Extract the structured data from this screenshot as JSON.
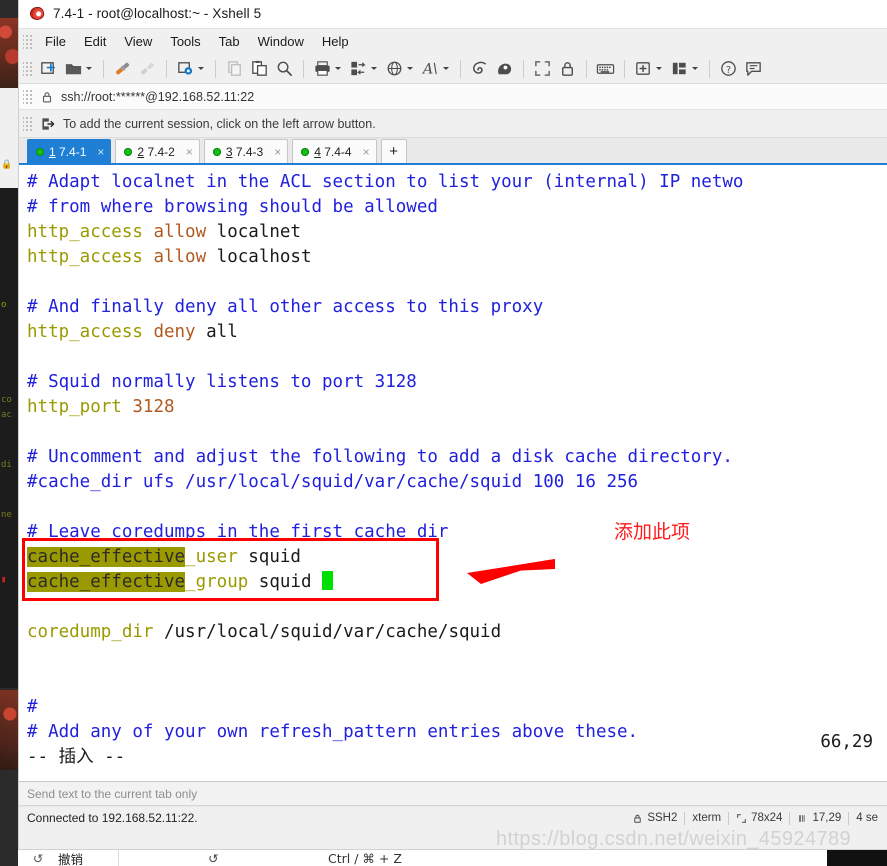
{
  "window": {
    "title": "7.4-1 - root@localhost:~ - Xshell 5",
    "app_icon": "xshell-icon"
  },
  "menu": {
    "items": [
      "File",
      "Edit",
      "View",
      "Tools",
      "Tab",
      "Window",
      "Help"
    ]
  },
  "toolbar": {
    "buttons": [
      {
        "name": "new-session-icon",
        "caret": false
      },
      {
        "name": "open-session-icon",
        "caret": true
      },
      {
        "name": "connect-icon",
        "caret": false
      },
      {
        "name": "disconnect-icon",
        "caret": false
      },
      {
        "name": "session-properties-icon",
        "caret": true
      },
      {
        "name": "copy-icon",
        "caret": false
      },
      {
        "name": "paste-icon",
        "caret": false
      },
      {
        "name": "find-icon",
        "caret": false
      },
      {
        "name": "print-icon",
        "caret": true
      },
      {
        "name": "file-transfer-icon",
        "caret": true
      },
      {
        "name": "web-browser-icon",
        "caret": true
      },
      {
        "name": "font-icon",
        "caret": true
      },
      {
        "name": "xshell-icon",
        "caret": false
      },
      {
        "name": "xftp-icon",
        "caret": false
      },
      {
        "name": "fullscreen-icon",
        "caret": false
      },
      {
        "name": "lock-icon",
        "caret": false
      },
      {
        "name": "keyboard-icon",
        "caret": false
      },
      {
        "name": "new-pane-icon",
        "caret": true
      },
      {
        "name": "arrange-layout-icon",
        "caret": true
      },
      {
        "name": "help-icon",
        "caret": false
      },
      {
        "name": "feedback-icon",
        "caret": false
      }
    ]
  },
  "urlbar": {
    "icon": "lock-icon",
    "value": "ssh://root:******@192.168.52.11:22"
  },
  "hintbar": {
    "icon": "add-session-arrow-icon",
    "text": "To add the current session, click on the left arrow button."
  },
  "tabs": {
    "items": [
      {
        "index": "1",
        "label": "7.4-1",
        "active": true
      },
      {
        "index": "2",
        "label": "7.4-2",
        "active": false
      },
      {
        "index": "3",
        "label": "7.4-3",
        "active": false
      },
      {
        "index": "4",
        "label": "7.4-4",
        "active": false
      }
    ],
    "add_label": "+",
    "close_glyph": "×",
    "accent_color": "#1f7fd4",
    "status_dot_color": "#16bd16"
  },
  "terminal": {
    "lines": [
      [
        {
          "t": "# Adapt localnet in the ACL section to list your (internal) IP netwo",
          "c": "comment"
        }
      ],
      [
        {
          "t": "# from where browsing should be allowed",
          "c": "comment"
        }
      ],
      [
        {
          "t": "http_access",
          "c": "key"
        },
        {
          "t": " ",
          "c": "plain"
        },
        {
          "t": "allow",
          "c": "val"
        },
        {
          "t": " localnet",
          "c": "plain"
        }
      ],
      [
        {
          "t": "http_access",
          "c": "key"
        },
        {
          "t": " ",
          "c": "plain"
        },
        {
          "t": "allow",
          "c": "val"
        },
        {
          "t": " localhost",
          "c": "plain"
        }
      ],
      [
        {
          "t": "",
          "c": "plain"
        }
      ],
      [
        {
          "t": "# And finally deny all other access to this proxy",
          "c": "comment"
        }
      ],
      [
        {
          "t": "http_access",
          "c": "key"
        },
        {
          "t": " ",
          "c": "plain"
        },
        {
          "t": "deny",
          "c": "val"
        },
        {
          "t": " all",
          "c": "plain"
        }
      ],
      [
        {
          "t": "",
          "c": "plain"
        }
      ],
      [
        {
          "t": "# Squid normally listens to port 3128",
          "c": "comment"
        }
      ],
      [
        {
          "t": "http_port",
          "c": "key"
        },
        {
          "t": " ",
          "c": "plain"
        },
        {
          "t": "3128",
          "c": "val"
        }
      ],
      [
        {
          "t": "",
          "c": "plain"
        }
      ],
      [
        {
          "t": "# Uncomment and adjust the following to add a disk cache directory.",
          "c": "comment"
        }
      ],
      [
        {
          "t": "#cache_dir ufs /usr/local/squid/var/cache/squid 100 16 256",
          "c": "comment"
        }
      ],
      [
        {
          "t": "",
          "c": "plain"
        }
      ],
      [
        {
          "t": "# Leave coredumps in the first cache dir",
          "c": "comment"
        }
      ],
      [
        {
          "t": "cache_effective",
          "c": "hl"
        },
        {
          "t": "_user",
          "c": "key"
        },
        {
          "t": " squid",
          "c": "plain"
        }
      ],
      [
        {
          "t": "cache_effective",
          "c": "hl"
        },
        {
          "t": "_group",
          "c": "key"
        },
        {
          "t": " squid ",
          "c": "plain"
        },
        {
          "t": "█",
          "c": "cursor"
        }
      ],
      [
        {
          "t": "",
          "c": "plain"
        }
      ],
      [
        {
          "t": "coredump_dir",
          "c": "key"
        },
        {
          "t": " /usr/local/squid/var/cache/squid",
          "c": "plain"
        }
      ],
      [
        {
          "t": "",
          "c": "plain"
        }
      ],
      [
        {
          "t": "",
          "c": "plain"
        }
      ],
      [
        {
          "t": "#",
          "c": "comment"
        }
      ],
      [
        {
          "t": "# Add any of your own refresh_pattern entries above these.",
          "c": "comment"
        }
      ],
      [
        {
          "t": "-- 插入 --",
          "c": "plain"
        }
      ]
    ],
    "cursor_position": "66,29",
    "colors": {
      "comment": "#2020dd",
      "key": "#9a9a00",
      "value": "#b05a20",
      "plain": "#1a1a1a",
      "highlight_bg": "#9a9a00",
      "cursor": "#00e000",
      "background": "#ffffff"
    }
  },
  "annotation": {
    "box_color": "#ff0000",
    "arrow_color": "#ff0000",
    "label": "添加此项",
    "label_color": "#ff1a1a"
  },
  "sendbar": {
    "text": "Send text to the current tab only"
  },
  "statusbar": {
    "left": "Connected to 192.168.52.11:22.",
    "protocol_icon": "lock-icon",
    "protocol": "SSH2",
    "terminal_type": "xterm",
    "size_icon": "resize-icon",
    "size": "78x24",
    "cursor_icon": "cursor-icon",
    "cursor": "17,29",
    "sessions": "4 se"
  },
  "watermark": {
    "text": "https://blog.csdn.net/weixin_45924789"
  },
  "context_menu": {
    "rows": [
      {
        "icon": "undo-icon",
        "label": "撤销",
        "symbol": "↺",
        "keys": "Ctrl / ⌘ + Z"
      }
    ]
  }
}
